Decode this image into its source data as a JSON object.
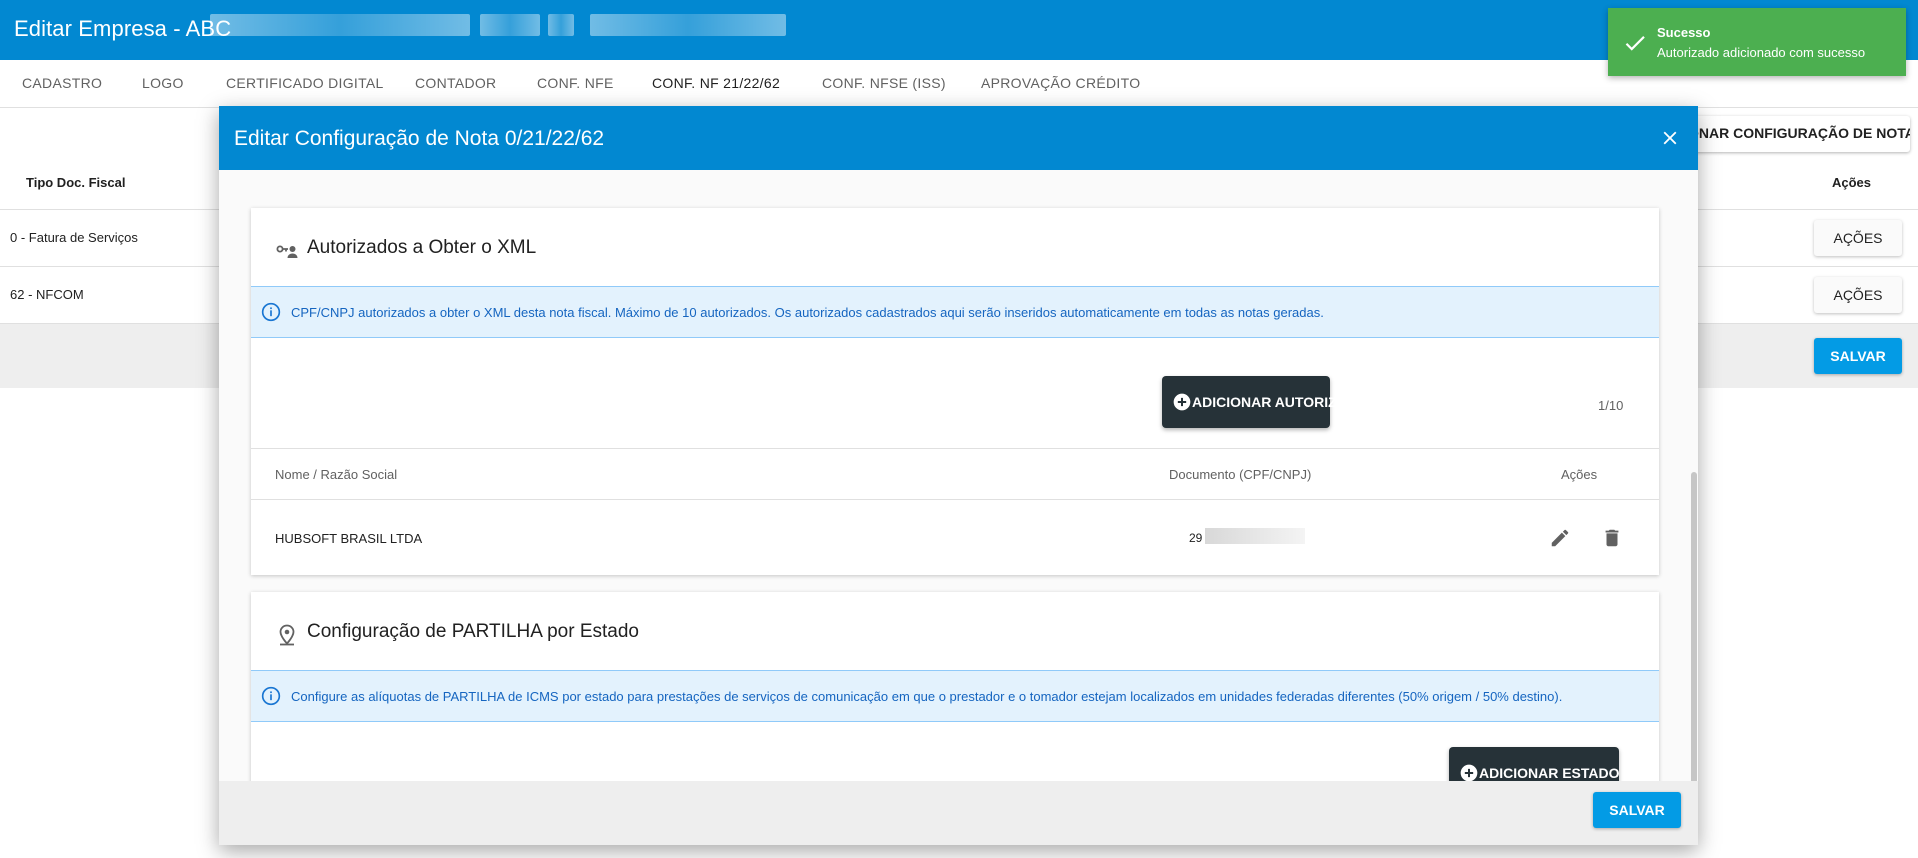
{
  "appbar": {
    "title": "Editar Empresa - ABC"
  },
  "tabs": [
    {
      "label": "CADASTRO"
    },
    {
      "label": "LOGO"
    },
    {
      "label": "CERTIFICADO DIGITAL"
    },
    {
      "label": "CONTADOR"
    },
    {
      "label": "CONF. NFE"
    },
    {
      "label": "CONF. NF 21/22/62"
    },
    {
      "label": "CONF. NFSE (ISS)"
    },
    {
      "label": "APROVAÇÃO CRÉDITO"
    }
  ],
  "active_tab": "CONF. NF 21/22/62",
  "background": {
    "add_config_button": "ONAR CONFIGURAÇÃO DE NOTA",
    "table": {
      "col_tipo": "Tipo Doc. Fiscal",
      "col_acoes": "Ações",
      "rows": [
        {
          "tipo": "0 - Fatura de Serviços",
          "acoes": "AÇÕES"
        },
        {
          "tipo": "62 - NFCOM",
          "acoes": "AÇÕES"
        }
      ]
    },
    "save_button": "SALVAR"
  },
  "toast": {
    "title": "Sucesso",
    "message": "Autorizado adicionado com sucesso",
    "color": "#4caf50"
  },
  "modal": {
    "title": "Editar Configuração de Nota 0/21/22/62",
    "save_button": "SALVAR",
    "autorizados": {
      "title": "Autorizados a Obter o XML",
      "info": "CPF/CNPJ autorizados a obter o XML desta nota fiscal. Máximo de 10 autorizados. Os autorizados cadastrados aqui serão inseridos automaticamente em todas as notas geradas.",
      "add_button": "ADICIONAR AUTORIZADO",
      "counter": "1/10",
      "columns": {
        "nome": "Nome / Razão Social",
        "documento": "Documento (CPF/CNPJ)",
        "acoes": "Ações"
      },
      "rows": [
        {
          "nome": "HUBSOFT BRASIL LTDA",
          "documento": "29"
        }
      ]
    },
    "partilha": {
      "title": "Configuração de PARTILHA por Estado",
      "info": "Configure as alíquotas de PARTILHA de ICMS por estado para prestações de serviços de comunicação em que o prestador e o tomador estejam localizados em unidades federadas diferentes (50% origem / 50% destino).",
      "add_button": "ADICIONAR ESTADO"
    }
  },
  "colors": {
    "primary": "#0288d1",
    "accent": "#039be5",
    "dark_button": "#263238",
    "info_bg": "#e3f2fd",
    "info_text": "#1565c0"
  }
}
